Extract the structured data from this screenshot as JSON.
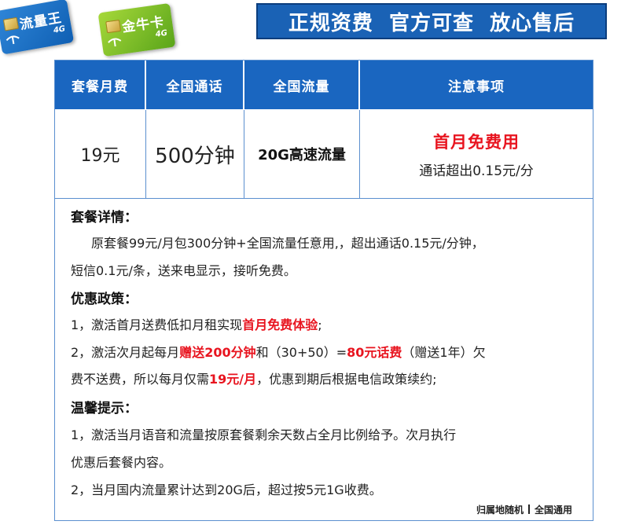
{
  "badges": {
    "blue_card": {
      "text": "流量王",
      "tag": "4G"
    },
    "green_card": {
      "text": "金牛卡",
      "tag": "4G"
    }
  },
  "slogan": "正规资费  官方可查  放心售后",
  "table": {
    "headers": [
      "套餐月费",
      "全国通话",
      "全国流量",
      "注意事项"
    ],
    "row": {
      "price": "19元",
      "minutes": "500分钟",
      "data": "20G高速流量",
      "note_highlight": "首月免费用",
      "note_detail": "通话超出0.15元/分"
    }
  },
  "details": {
    "title": "套餐详情：",
    "line1": "原套餐99元/月包300分钟+全国流量任意用,，超出通话0.15元/分钟，",
    "line2": "短信0.1元/条，送来电显示，接听免费。"
  },
  "policy": {
    "title": "优惠政策：",
    "item1_prefix": "1，激活首月送费低扣月租实现",
    "item1_red": "首月免费体验",
    "item1_suffix": ";",
    "item2_prefix": "2，激活次月起每月",
    "item2_red1": "赠送200分钟",
    "item2_mid": "和（30+50）=",
    "item2_red2": "80元话费",
    "item2_suffix": "（赠送1年）欠",
    "item2_line2_prefix": "费不送费，所以每月仅需",
    "item2_red3": "19元/月",
    "item2_line2_suffix": "，优惠到期后根据电信政策续约;"
  },
  "tips": {
    "title": "温馨提示：",
    "item1_line1": "1，激活当月语音和流量按原套餐剩余天数占全月比例给予。次月执行",
    "item1_line2": "优惠后套餐内容。",
    "item2": "2，当月国内流量累计达到20G后，超过按5元1G收费。"
  },
  "footer": {
    "left": "归属地随机",
    "right": "全国通用"
  },
  "colors": {
    "header_blue": "#1a66c0",
    "highlight_red": "#e8141f",
    "border_blue": "#5b8fcf"
  }
}
